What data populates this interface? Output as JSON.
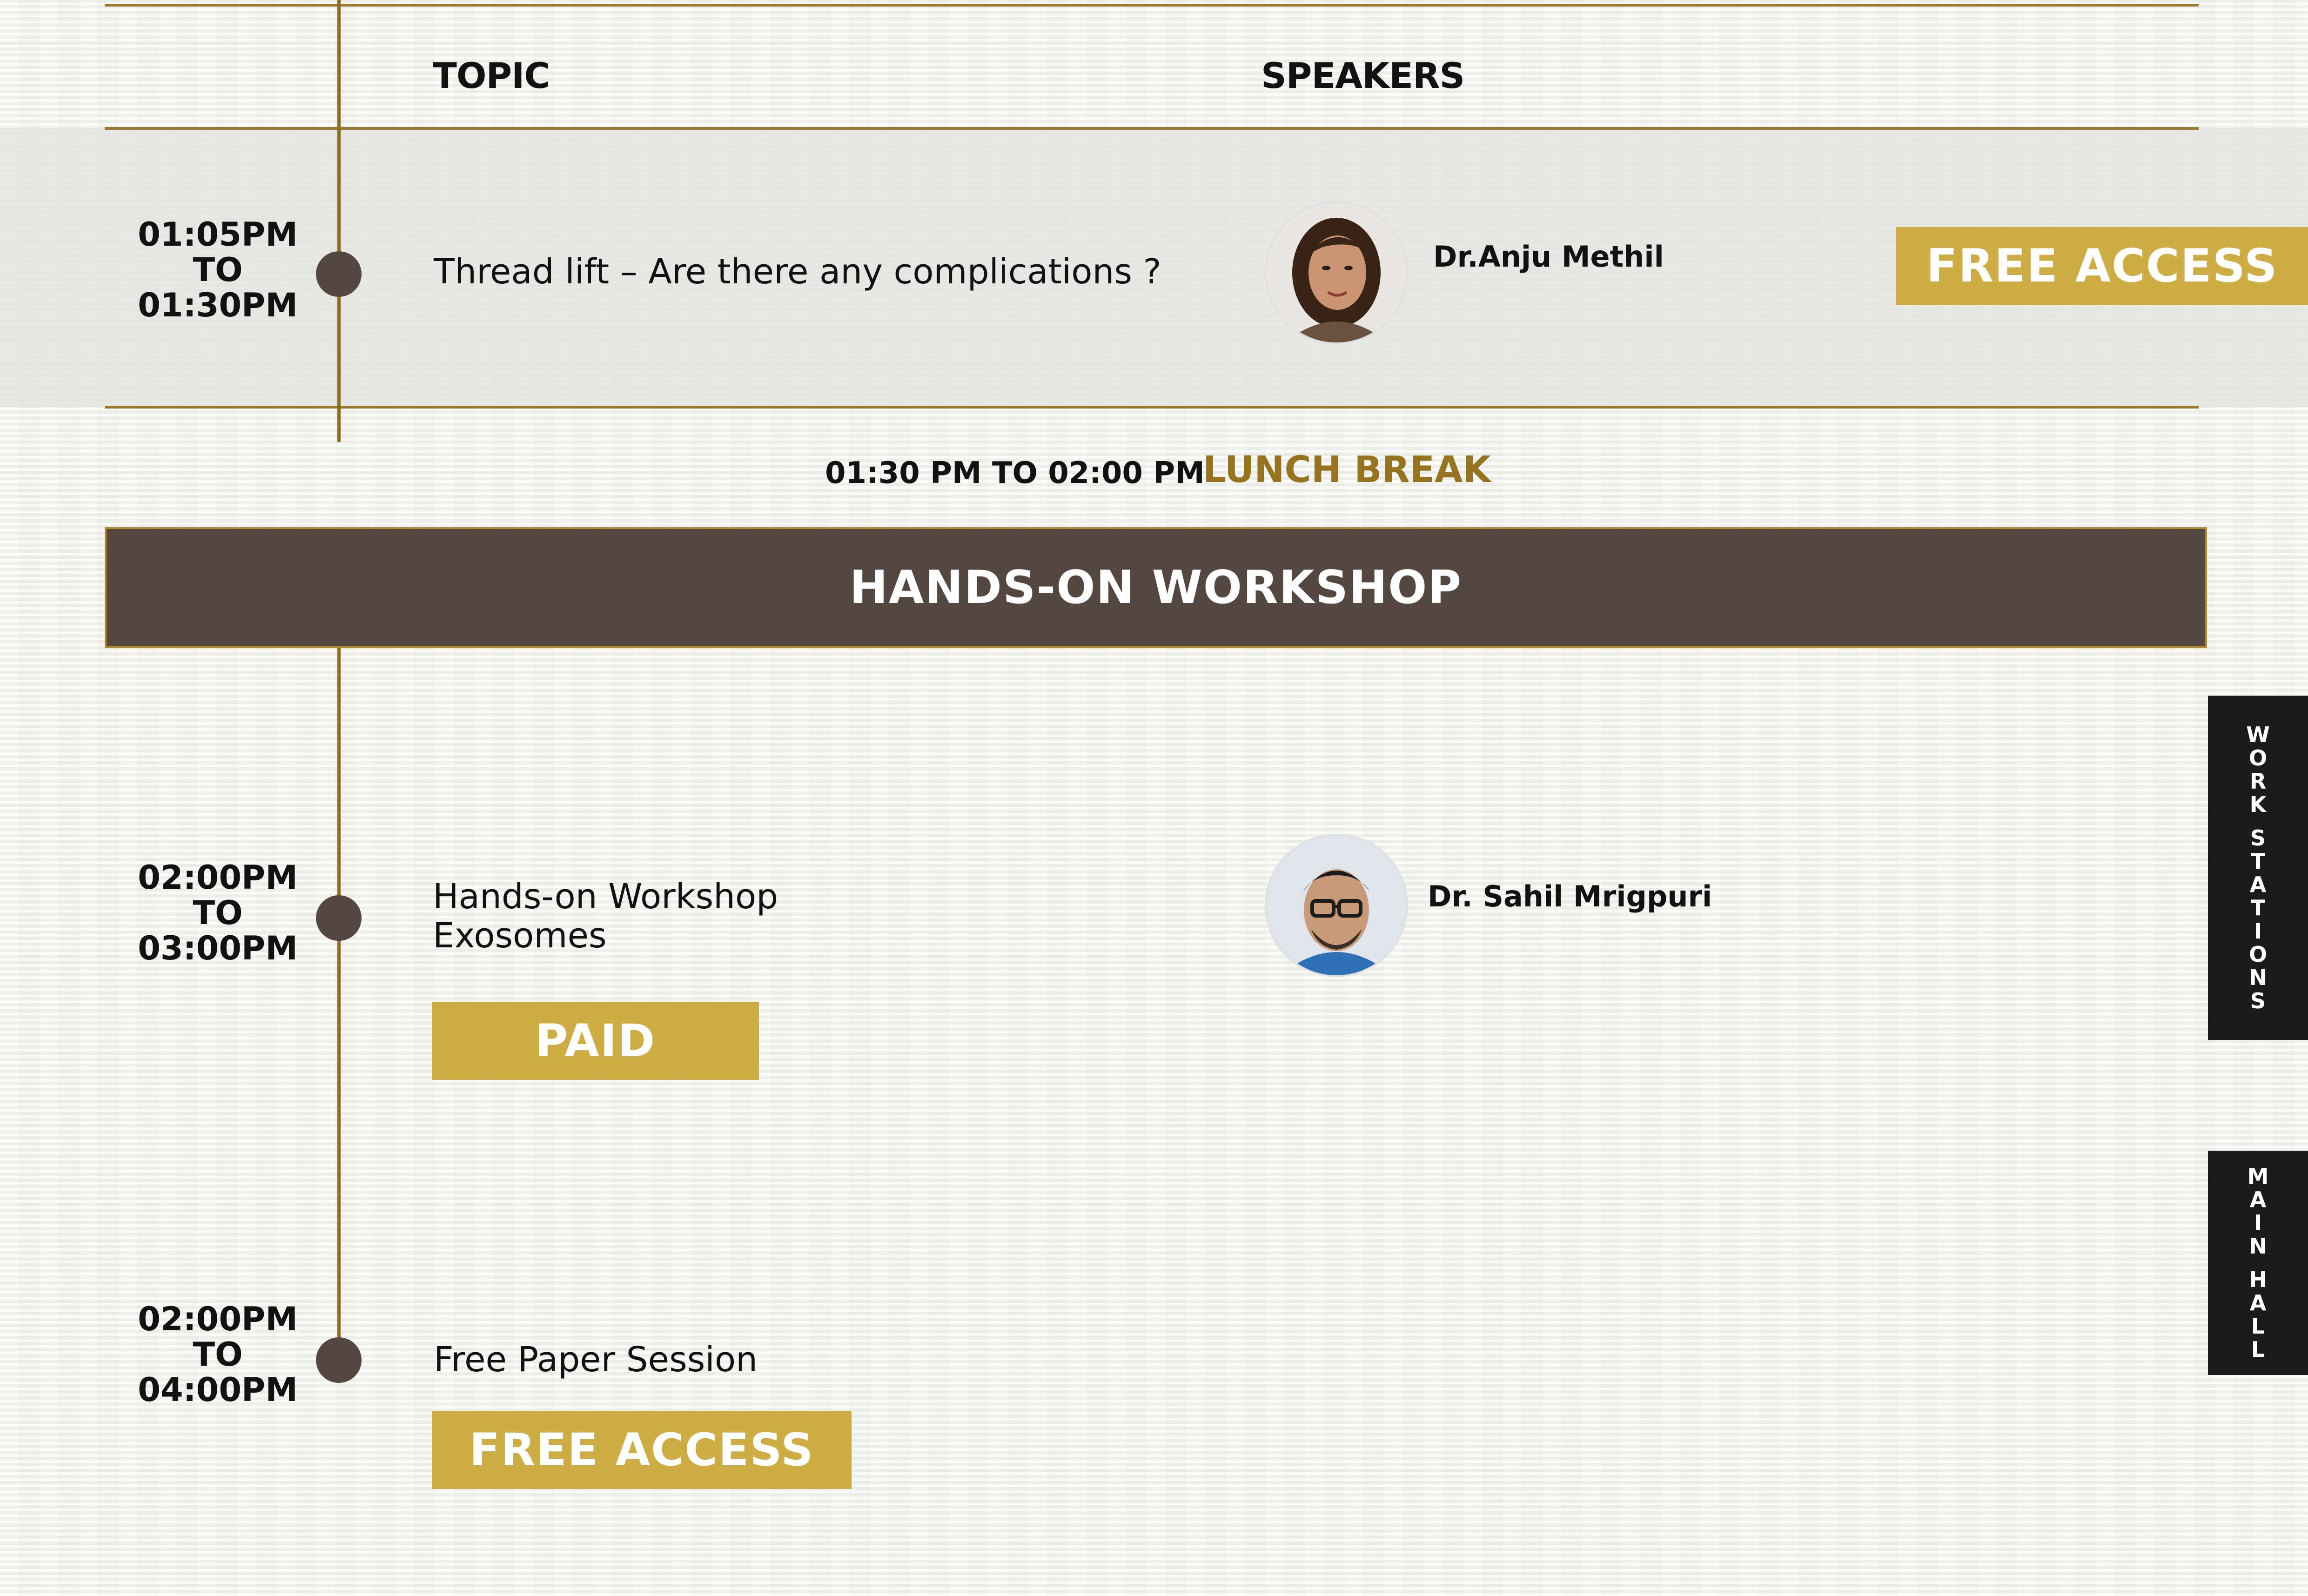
{
  "header": {
    "topic_label": "TOPIC",
    "speakers_label": "SPEAKERS"
  },
  "sessions": [
    {
      "time_start": "01:05PM",
      "time_to": "TO",
      "time_end": "01:30PM",
      "topic": "Thread lift – Are there any complications ?",
      "speaker": "Dr.Anju Methil",
      "access": "FREE ACCESS"
    }
  ],
  "lunch": {
    "time": "01:30 PM TO 02:00 PM",
    "label": "LUNCH BREAK"
  },
  "workshop": {
    "banner": "HANDS-ON WORKSHOP",
    "sessions": [
      {
        "time_start": "02:00PM",
        "time_to": "TO",
        "time_end": "03:00PM",
        "topic_line1": "Hands-on Workshop",
        "topic_line2": "Exosomes",
        "speaker": "Dr. Sahil Mrigpuri",
        "access": "PAID"
      },
      {
        "time_start": "02:00PM",
        "time_to": "TO",
        "time_end": "04:00PM",
        "topic": "Free Paper Session",
        "access": "FREE ACCESS"
      }
    ]
  },
  "side_tabs": {
    "work_stations": [
      "W",
      "O",
      "R",
      "K",
      "",
      "S",
      "T",
      "A",
      "T",
      "I",
      "O",
      "N",
      "S"
    ],
    "main_hall": [
      "M",
      "A",
      "I",
      "N",
      "",
      "H",
      "A",
      "L",
      "L"
    ]
  },
  "colors": {
    "gold": "#cfad45",
    "gold_line": "#9a7a2c",
    "brown": "#544640",
    "lunch_text": "#96731f",
    "dark_tab": "#1b1b1b"
  }
}
